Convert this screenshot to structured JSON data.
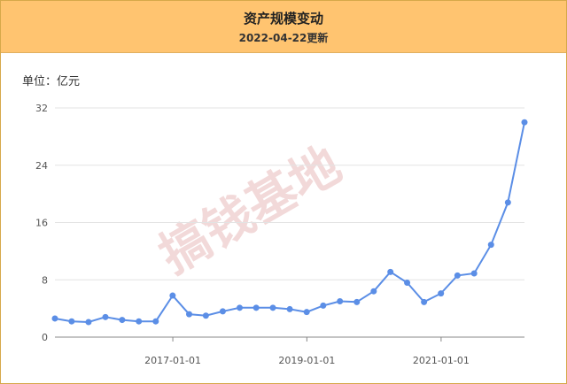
{
  "header": {
    "title": "资产规模变动",
    "subtitle": "2022-04-22更新"
  },
  "unit_label": "单位：亿元",
  "watermark": "搞钱基地",
  "colors": {
    "header_bg": "#ffc470",
    "line": "#5b8ee6",
    "grid": "#e3e3e3"
  },
  "chart_data": {
    "type": "line",
    "title": "资产规模变动",
    "ylabel": "单位：亿元",
    "ylim": [
      0,
      32
    ],
    "yticks": [
      0,
      8,
      16,
      24,
      32
    ],
    "xticks": [
      "2017-01-01",
      "2019-01-01",
      "2021-01-01"
    ],
    "grid": true,
    "series": [
      {
        "x": [
          "2015-03-31",
          "2015-06-30",
          "2015-09-30",
          "2015-12-31",
          "2016-03-31",
          "2016-06-30",
          "2016-09-30",
          "2016-12-31",
          "2017-03-31",
          "2017-06-30",
          "2017-09-30",
          "2017-12-31",
          "2018-03-31",
          "2018-06-30",
          "2018-09-30",
          "2018-12-31",
          "2019-03-31",
          "2019-06-30",
          "2019-09-30",
          "2019-12-31",
          "2020-03-31",
          "2020-06-30",
          "2020-09-30",
          "2020-12-31",
          "2021-03-31",
          "2021-06-30",
          "2021-09-30",
          "2021-12-31",
          "2022-03-31"
        ],
        "values": [
          2.6,
          2.2,
          2.1,
          2.8,
          2.4,
          2.2,
          2.2,
          5.8,
          3.2,
          3.0,
          3.6,
          4.1,
          4.1,
          4.1,
          3.9,
          3.5,
          4.4,
          5.0,
          4.9,
          6.4,
          9.1,
          7.6,
          4.9,
          6.1,
          8.6,
          8.9,
          12.9,
          18.8,
          30.0
        ]
      }
    ]
  }
}
